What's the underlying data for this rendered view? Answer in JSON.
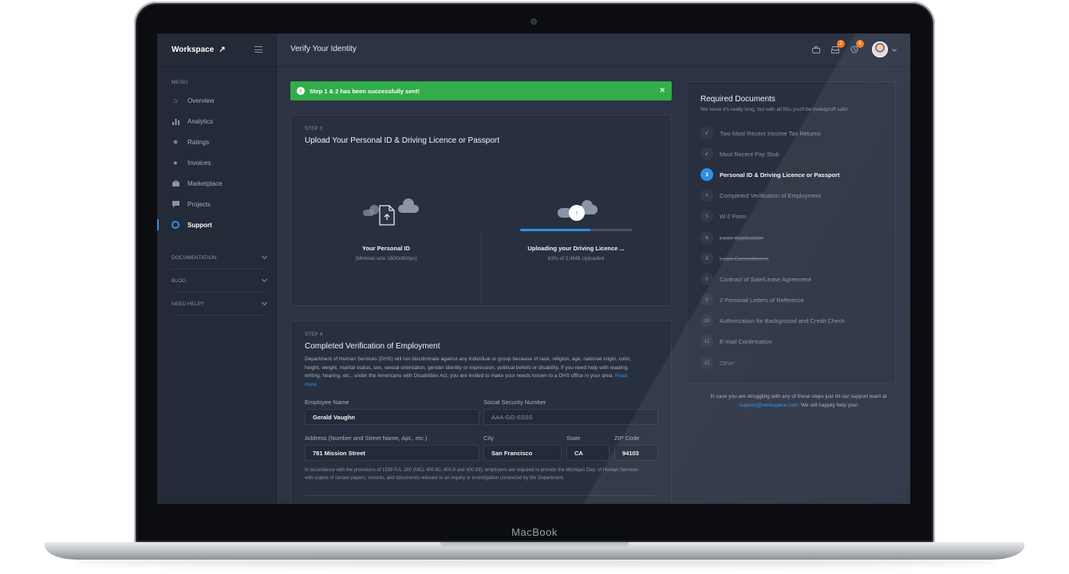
{
  "device": {
    "brand": "MacBook"
  },
  "sidebar": {
    "brand": "Workspace",
    "menu_heading": "MENU",
    "items": [
      {
        "label": "Overview",
        "icon": "home-icon"
      },
      {
        "label": "Analytics",
        "icon": "bar-chart-icon"
      },
      {
        "label": "Ratings",
        "icon": "star-icon"
      },
      {
        "label": "Invoices",
        "icon": "coins-icon"
      },
      {
        "label": "Marketplace",
        "icon": "briefcase-icon"
      },
      {
        "label": "Projects",
        "icon": "chat-icon"
      },
      {
        "label": "Support",
        "icon": "lifebuoy-icon",
        "active": true
      }
    ],
    "groups": [
      {
        "label": "DOCUMENTATION"
      },
      {
        "label": "BLOG"
      },
      {
        "label": "NEED HELP?"
      }
    ]
  },
  "topbar": {
    "title": "Verify Your Identity",
    "notifications_badge": "2",
    "alerts_badge": "4"
  },
  "alert": {
    "message": "Step 1 & 2 has been successfully sent!",
    "color": "#32ad4a"
  },
  "step3": {
    "label": "STEP 3",
    "title": "Upload Your Personal ID & Driving Licence or Passport",
    "personal_id": {
      "name": "Your Personal ID",
      "sub": "(Minimal size 1600x900px)"
    },
    "driving_licence": {
      "name": "Uploading your Driving Licence ...",
      "sub": "63% of 2,4MB Uploaded",
      "progress": 0.63
    }
  },
  "step4": {
    "label": "STEP 4",
    "title": "Completed Verification of Employment",
    "description": "Department of Human Services (DHS) will not discriminate against any individual or group because of race, religion, age, national origin, color, height, weight, marital status, sex, sexual orientation, gender identity or expression, political beliefs or disability. If you need help with reading, writing, hearing, etc., under the Americans with Disabilities Act, you are invited to make your needs known to a DHS office in your area.",
    "read_more": "Read more",
    "fields": {
      "employee_name": {
        "label": "Employee Name",
        "value": "Gerald Vaughn"
      },
      "ssn": {
        "label": "Social Security Number",
        "placeholder": "AAA-GG-SSSS"
      },
      "address": {
        "label": "Address (Number and Street Name, Apt., etc.)",
        "value": "781 Mission Street"
      },
      "city": {
        "label": "City",
        "value": "San Francisco"
      },
      "state": {
        "label": "State",
        "value": "CA"
      },
      "zip": {
        "label": "ZIP Code",
        "value": "94103"
      }
    },
    "fine_print": "In accordance with the provisions of 1939 P.A. 280 (MCL 400.60, 400.8 and 400.83), employers are required to provide the Michigan Dep. of Human Services with copies of certain papers, records, and documents relevant to an inquiry or investigation conducted by the Department."
  },
  "required": {
    "title": "Required Documents",
    "subtitle": "We know it's really long, but with all this you'll be bulletproff safe!",
    "items": [
      {
        "num": "✓",
        "label": "Two Most Recent Income Tax Returns",
        "state": "done"
      },
      {
        "num": "✓",
        "label": "Most Recent Pay Stub",
        "state": "done"
      },
      {
        "num": "3",
        "label": "Personal ID & Driving Licence or Passport",
        "state": "current"
      },
      {
        "num": "4",
        "label": "Completed Verification of Employment",
        "state": "pending"
      },
      {
        "num": "5",
        "label": "W-2 Form",
        "state": "pending"
      },
      {
        "num": "6",
        "label": "Loan Application",
        "state": "struck"
      },
      {
        "num": "7",
        "label": "Loan Commitment",
        "state": "struck"
      },
      {
        "num": "8",
        "label": "Contract of Sale/Lease Agreement",
        "state": "pending"
      },
      {
        "num": "9",
        "label": "2 Personal Letters of Reference",
        "state": "pending"
      },
      {
        "num": "10",
        "label": "Authorization for Background and Credit Check",
        "state": "pending"
      },
      {
        "num": "11",
        "label": "E-mail Confirmation",
        "state": "pending"
      },
      {
        "num": "12",
        "label": "Other",
        "state": "faint"
      }
    ],
    "help_prefix": "In case you are struggling with any of these steps just hit our support team at",
    "help_email": "support@workspace.com",
    "help_suffix": ". We will happily help you!"
  },
  "colors": {
    "accent": "#2f8fe6",
    "success": "#32ad4a",
    "badge": "#f07b20",
    "background": "#2b3344"
  }
}
